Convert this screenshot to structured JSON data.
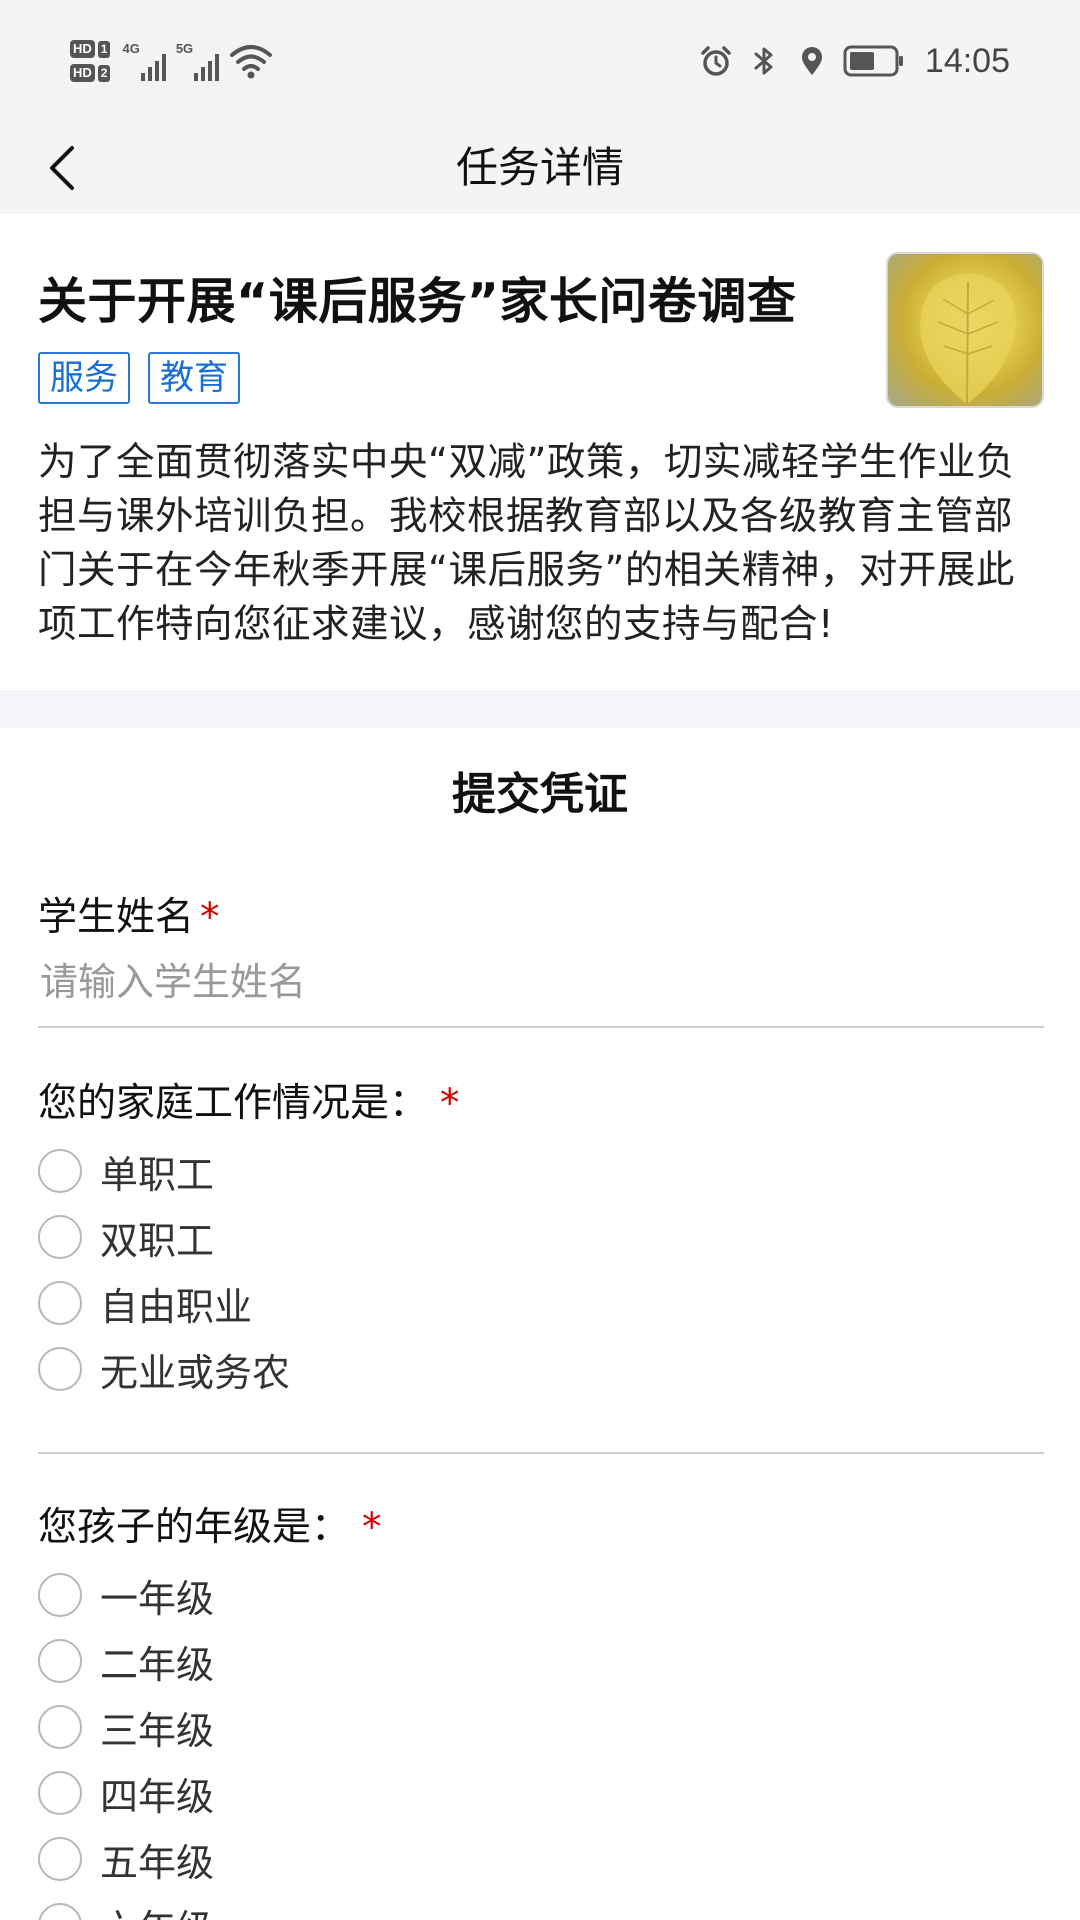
{
  "status_bar": {
    "sim1_label": "HD",
    "sim1_num": "1",
    "sim2_label": "HD",
    "sim2_num": "2",
    "net1": "4G",
    "net2": "5G",
    "time": "14:05",
    "icons": [
      "alarm-icon",
      "bluetooth-icon",
      "location-icon",
      "battery-icon"
    ]
  },
  "nav": {
    "title": "任务详情"
  },
  "task": {
    "title": "关于开展“课后服务”家长问卷调查",
    "tags": [
      "服务",
      "教育"
    ],
    "description": "为了全面贯彻落实中央“双减”政策，切实减轻学生作业负担与课外培训负担。我校根据教育部以及各级教育主管部门关于在今年秋季开展“课后服务”的相关精神，对开展此项工作特向您征求建议，感谢您的支持与配合!"
  },
  "form": {
    "section_title": "提交凭证",
    "required_mark": "*",
    "student_name": {
      "label": "学生姓名",
      "placeholder": "请输入学生姓名",
      "value": ""
    },
    "family_work": {
      "label": "您的家庭工作情况是：",
      "options": [
        "单职工",
        "双职工",
        "自由职业",
        "无业或务农"
      ]
    },
    "grade": {
      "label": "您孩子的年级是：",
      "options": [
        "一年级",
        "二年级",
        "三年级",
        "四年级",
        "五年级",
        "六年级"
      ]
    }
  },
  "colors": {
    "accent_blue": "#1a6fd6",
    "required_red": "#d40000",
    "header_bg": "#f4f4f4"
  }
}
